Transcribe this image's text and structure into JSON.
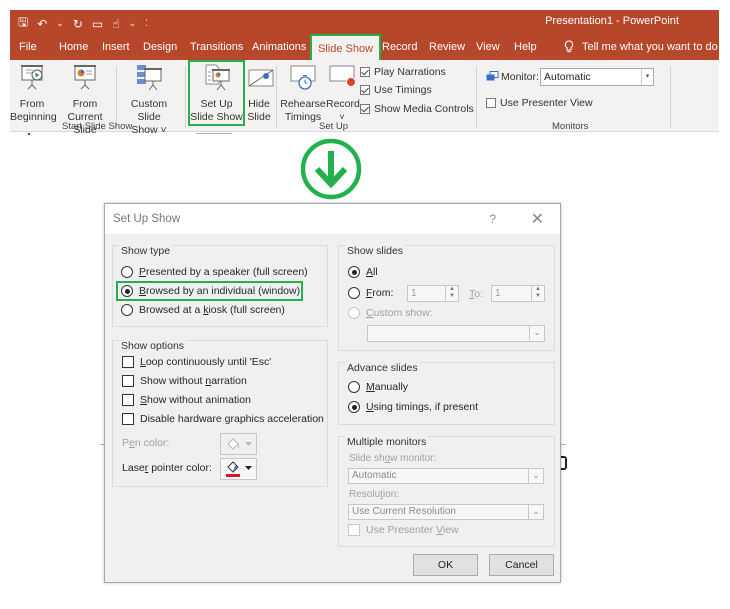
{
  "app": {
    "title": "Presentation1  -  PowerPoint",
    "accent_color": "#b7472a",
    "highlight_color": "#22b14c"
  },
  "quick_access": [
    {
      "icon": "save-icon",
      "glyph": "🖫"
    },
    {
      "icon": "undo-icon",
      "glyph": "↶"
    },
    {
      "icon": "undo-dropdown-icon",
      "glyph": "⌄"
    },
    {
      "icon": "redo-icon",
      "glyph": "↻"
    },
    {
      "icon": "present-icon",
      "glyph": "▭"
    },
    {
      "icon": "touch-mode-icon",
      "glyph": "☝"
    },
    {
      "icon": "customize-dropdown-icon",
      "glyph": "⌄"
    },
    {
      "icon": "more-icon",
      "glyph": "⁚"
    }
  ],
  "tabs": [
    {
      "label": "File"
    },
    {
      "label": "Home"
    },
    {
      "label": "Insert"
    },
    {
      "label": "Design"
    },
    {
      "label": "Transitions"
    },
    {
      "label": "Animations"
    },
    {
      "label": "Slide Show",
      "active": true
    },
    {
      "label": "Record"
    },
    {
      "label": "Review"
    },
    {
      "label": "View"
    },
    {
      "label": "Help"
    }
  ],
  "tell_me": {
    "icon": "lightbulb-icon",
    "placeholder": "Tell me what you want to do"
  },
  "ribbon": {
    "start_slide_show": {
      "label": "Start Slide Show",
      "from_beginning": [
        "From",
        "Beginning"
      ],
      "from_current": [
        "From",
        "Current Slide"
      ],
      "custom_slide_show": [
        "Custom Slide",
        "Show ˅"
      ]
    },
    "set_up": {
      "label": "Set Up",
      "set_up_slide_show": [
        "Set Up",
        "Slide Show"
      ],
      "hide_slide": [
        "Hide",
        "Slide"
      ],
      "rehearse_timings": [
        "Rehearse",
        "Timings"
      ],
      "record": [
        "Record",
        "˅"
      ],
      "checks": [
        {
          "label": "Play Narrations",
          "checked": true
        },
        {
          "label": "Use Timings",
          "checked": true
        },
        {
          "label": "Show Media Controls",
          "checked": true
        }
      ]
    },
    "monitors": {
      "label": "Monitors",
      "monitor_label": "Monitor:",
      "monitor_value": "Automatic",
      "use_presenter_view": {
        "label": "Use Presenter View",
        "checked": false
      }
    }
  },
  "dialog": {
    "title": "Set Up Show",
    "help": "?",
    "close": "✕",
    "show_type": {
      "title": "Show type",
      "options": [
        {
          "pre": "",
          "u": "P",
          "post": "resented by a speaker (full screen)",
          "selected": false
        },
        {
          "pre": "",
          "u": "B",
          "post": "rowsed by an individual (window)",
          "selected": true
        },
        {
          "pre": "Browsed at a ",
          "u": "k",
          "post": "iosk (full screen)",
          "selected": false
        }
      ]
    },
    "show_options": {
      "title": "Show options",
      "checks": [
        {
          "pre": "",
          "u": "L",
          "post": "oop continuously until 'Esc'",
          "checked": false
        },
        {
          "pre": "Show without ",
          "u": "n",
          "post": "arration",
          "checked": false
        },
        {
          "pre": "",
          "u": "S",
          "post": "how without animation",
          "checked": false
        },
        {
          "pre": "Disable hardware ",
          "u": "g",
          "post": "raphics acceleration",
          "checked": false
        }
      ],
      "pen_color": {
        "pre": "P",
        "u": "e",
        "post": "n color:",
        "disabled": true
      },
      "laser_color": {
        "pre": "Lase",
        "u": "r",
        "post": " pointer color:",
        "swatch": "#e81123"
      }
    },
    "show_slides": {
      "title": "Show slides",
      "all": {
        "u": "A",
        "post": "ll",
        "selected": true
      },
      "from": {
        "u": "F",
        "post": "rom:",
        "selected": false,
        "value": "1"
      },
      "to": {
        "u": "T",
        "post": "o:",
        "value": "1"
      },
      "custom_show": {
        "u": "C",
        "post": "ustom show:",
        "disabled": true,
        "value": ""
      }
    },
    "advance_slides": {
      "title": "Advance slides",
      "manually": {
        "u": "M",
        "post": "anually",
        "selected": false
      },
      "timings": {
        "u": "U",
        "post": "sing timings, if present",
        "selected": true
      }
    },
    "multiple_monitors": {
      "title": "Multiple monitors",
      "monitor_label": {
        "pre": "Slide sh",
        "u": "o",
        "post": "w monitor:"
      },
      "monitor_value": "Automatic",
      "resolution_label": {
        "pre": "Resolu",
        "u": "t",
        "post": "ion:"
      },
      "resolution_value": "Use Current Resolution",
      "presenter_view": {
        "pre": "Use Presenter ",
        "u": "V",
        "post": "iew",
        "checked": false
      }
    },
    "ok": "OK",
    "cancel": "Cancel"
  }
}
